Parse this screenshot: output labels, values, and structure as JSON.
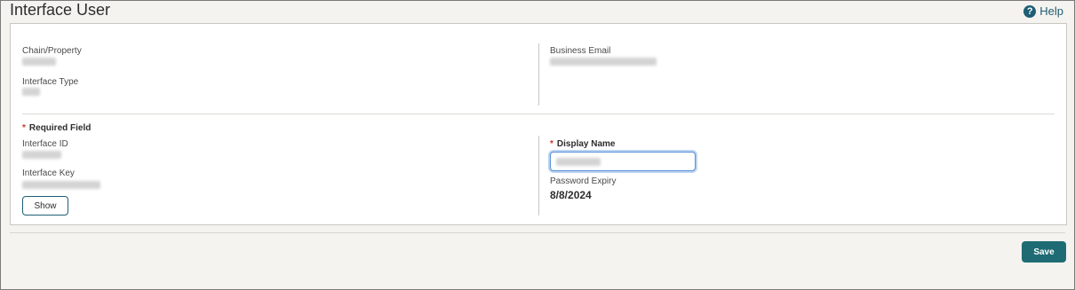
{
  "page": {
    "title": "Interface User"
  },
  "help": {
    "label": "Help"
  },
  "info": {
    "chain_property_label": "Chain/Property",
    "interface_type_label": "Interface Type",
    "business_email_label": "Business Email"
  },
  "form": {
    "required_field": "Required Field",
    "interface_id_label": "Interface ID",
    "interface_key_label": "Interface Key",
    "show_label": "Show",
    "display_name_label": "Display Name",
    "password_expiry_label": "Password Expiry",
    "password_expiry_value": "8/8/2024"
  },
  "footer": {
    "save_label": "Save"
  },
  "colors": {
    "accent": "#1f6b73",
    "required_star": "#c0392b",
    "focus_border": "#5a8fd6"
  }
}
